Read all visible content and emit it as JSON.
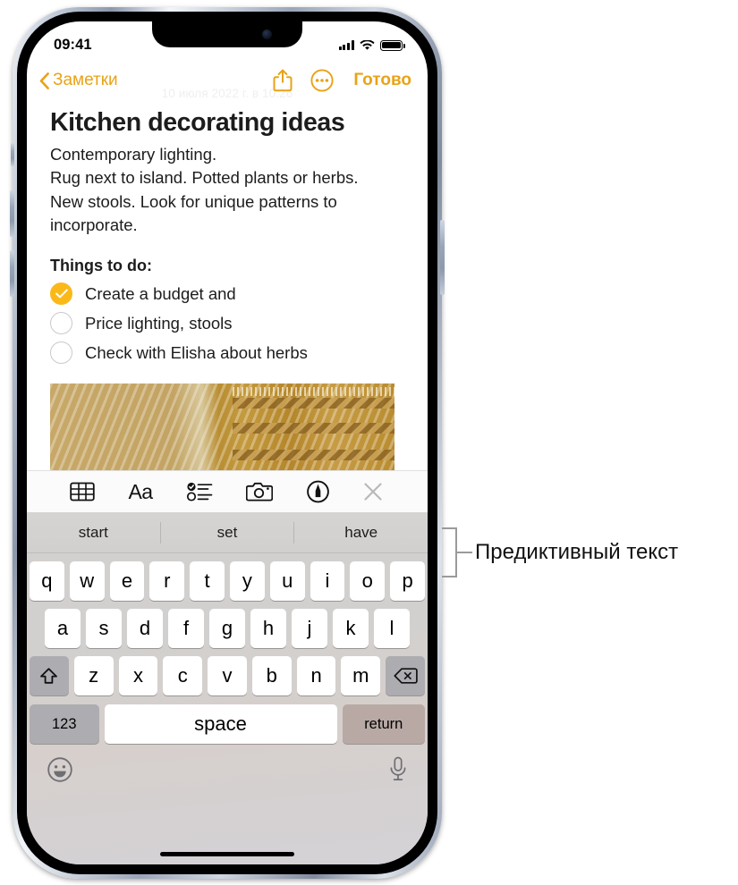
{
  "status_bar": {
    "time": "09:41",
    "cellular_icon": "cellular-bars-icon",
    "wifi_icon": "wifi-icon",
    "battery_icon": "battery-full-icon"
  },
  "nav_bar": {
    "back_label": "Заметки",
    "back_icon": "chevron-left-icon",
    "share_icon": "share-icon",
    "more_icon": "ellipsis-circle-icon",
    "done_label": "Готово"
  },
  "note": {
    "date": "10 июля 2022 г. в 10:26",
    "title": "Kitchen decorating ideas",
    "lines": [
      "Contemporary lighting.",
      "Rug next to island.  Potted plants or herbs.",
      "New stools. Look for unique patterns to",
      "incorporate."
    ],
    "things_label": "Things to do:",
    "checklist": [
      {
        "text": "Create a budget and",
        "checked": true
      },
      {
        "text": "Price lighting, stools",
        "checked": false
      },
      {
        "text": "Check with Elisha about herbs",
        "checked": false
      }
    ],
    "attachment_name": "photo-attachment"
  },
  "format_toolbar": {
    "items": [
      {
        "name": "table-icon",
        "label": ""
      },
      {
        "name": "text-format-icon",
        "label": "Aa"
      },
      {
        "name": "checklist-icon",
        "label": ""
      },
      {
        "name": "camera-icon",
        "label": ""
      },
      {
        "name": "markup-pen-icon",
        "label": ""
      },
      {
        "name": "close-icon",
        "label": ""
      }
    ]
  },
  "keyboard": {
    "predictive": [
      "start",
      "set",
      "have"
    ],
    "row1": [
      "q",
      "w",
      "e",
      "r",
      "t",
      "y",
      "u",
      "i",
      "o",
      "p"
    ],
    "row2": [
      "a",
      "s",
      "d",
      "f",
      "g",
      "h",
      "j",
      "k",
      "l"
    ],
    "row3": [
      "z",
      "x",
      "c",
      "v",
      "b",
      "n",
      "m"
    ],
    "shift_icon": "shift-up-arrow-icon",
    "delete_icon": "delete-backspace-icon",
    "numbers_label": "123",
    "space_label": "space",
    "return_label": "return",
    "emoji_icon": "emoji-smiley-icon",
    "dictation_icon": "microphone-icon"
  },
  "annotation": {
    "label": "Предиктивный текст"
  },
  "colors": {
    "accent": "#E8A317",
    "checkbox_checked": "#FBB919",
    "keyboard_bg": "#D3D1CF",
    "key_bg": "#FFFFFF",
    "key_fn_bg": "#ADACB0"
  }
}
